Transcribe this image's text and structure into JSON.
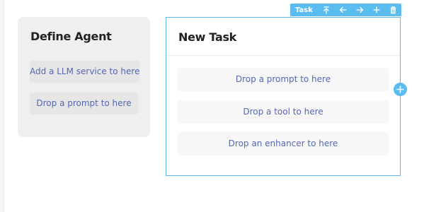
{
  "agent_card": {
    "title": "Define Agent",
    "slots": [
      "Add a LLM service to here",
      "Drop a prompt to here"
    ]
  },
  "task_card": {
    "title": "New Task",
    "slots": [
      "Drop a prompt to here",
      "Drop a tool to here",
      "Drop an enhancer to here"
    ]
  },
  "toolbar": {
    "label": "Task",
    "icons": [
      "move-up-icon",
      "arrow-left-icon",
      "arrow-right-icon",
      "plus-icon",
      "trash-icon"
    ]
  },
  "colors": {
    "accent": "#5bbcf0",
    "slot_text": "#5567b2",
    "agent_bg": "#efefef"
  }
}
